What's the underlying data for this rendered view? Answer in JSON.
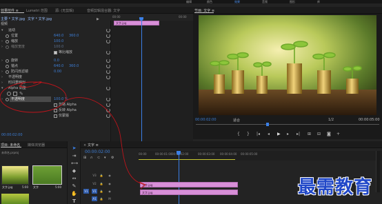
{
  "menubar": {
    "items": [
      "编辑",
      "颜色",
      "效果",
      "音频",
      "图形",
      "库"
    ],
    "active_index": 2
  },
  "effect_controls": {
    "tabs": [
      "效果控件 ≡",
      "Lumetri 范围",
      "源: (无剪辑)",
      "音频剪辑混合器: 文字"
    ],
    "source_path": "主要 * 文字.jpg",
    "sequence_path": "文字 * 文字.jpg",
    "timecode_start": "00:00",
    "timecode_end": "00:00",
    "clip_label": "文字.jpg",
    "section_video": "视频",
    "rows": [
      {
        "label": "运动",
        "value": ""
      },
      {
        "label": "位置",
        "value": "640.0"
      },
      {
        "label": "缩放",
        "value": "100.0"
      },
      {
        "label": "缩放宽度",
        "value": "100.0"
      },
      {
        "label": "等比缩放",
        "value": ""
      },
      {
        "label": "旋转",
        "value": "0.0"
      },
      {
        "label": "锚点",
        "value": "640.0"
      },
      {
        "label": "防闪烁滤镜",
        "value": "0.00"
      },
      {
        "label": "不透明度",
        "value": ""
      },
      {
        "label": "时间重映射",
        "value": ""
      },
      {
        "label": "Alpha 调整",
        "value": ""
      },
      {
        "label": "不透明度",
        "value": "100.0 %"
      },
      {
        "label": "忽略 Alpha",
        "value": ""
      },
      {
        "label": "反转 Alpha",
        "value": ""
      },
      {
        "label": "仅蒙版",
        "value": ""
      }
    ],
    "position_y": "360.0",
    "anchor_y": "360.0"
  },
  "program_monitor": {
    "title": "节目: 文字 ≡",
    "timecode_current": "00:00:02:00",
    "fit_label": "适合",
    "quality": "1/2",
    "timecode_total": "00:00:05:00"
  },
  "project": {
    "tabs": [
      "项目: 未命名",
      "媒体浏览器"
    ],
    "file_name": "未命名.prproj",
    "items": [
      {
        "name": "文字.jpg",
        "duration": "5:00"
      },
      {
        "name": "文字",
        "duration": "5:00"
      }
    ]
  },
  "timeline": {
    "title": "文字 ≡",
    "timecode": "00:00:02:00",
    "ruler_labels": [
      "00:00",
      "00:00:01:00",
      "00:00:02:00",
      "00:00:03:00",
      "00:00:04:00",
      "00:00:05:00"
    ],
    "tracks": [
      "V3",
      "V2",
      "V1",
      "A1"
    ],
    "clips": [
      {
        "track": "V2",
        "label": "文字.jpg"
      },
      {
        "track": "V1",
        "label": "文字.jpg"
      }
    ]
  },
  "watermark": {
    "text": "最需教育"
  },
  "colors": {
    "accent_blue": "#3d7ed6",
    "clip_pink": "#d88fd8",
    "playhead": "#3b80e8",
    "annotation_red": "#c0141b"
  }
}
